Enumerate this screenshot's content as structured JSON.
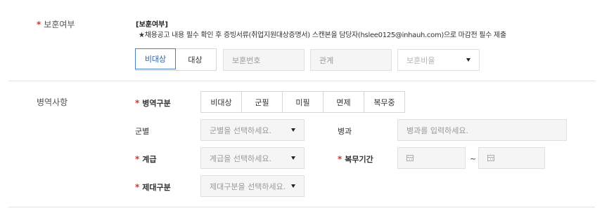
{
  "veteran": {
    "label": "보훈여부",
    "notice_title": "[보훈여부]",
    "notice_text": "★채용공고 내용 필수 확인 후 증빙서류(취업지원대상증명서) 스캔본을 담당자(hslee0125@inhauh.com)으로 마감전 필수 제출",
    "options": [
      "비대상",
      "대상"
    ],
    "selected": "비대상",
    "number_placeholder": "보훈번호",
    "relation_placeholder": "관계",
    "ratio_placeholder": "보훈비율"
  },
  "military": {
    "label": "병역사항",
    "type_label": "병역구분",
    "types": [
      "비대상",
      "군필",
      "미필",
      "면제",
      "복무중"
    ],
    "branch_label": "군별",
    "branch_placeholder": "군별을 선택하세요.",
    "specialty_label": "병과",
    "specialty_placeholder": "병과를 입력하세요.",
    "rank_label": "계급",
    "rank_placeholder": "계급을 선택하세요.",
    "period_label": "복무기간",
    "period_separator": "~",
    "discharge_label": "제대구분",
    "discharge_placeholder": "제대구분을 선택하세요."
  },
  "required_mark": "*",
  "colors": {
    "accent": "#4a7fc1",
    "required": "#e0312d"
  }
}
